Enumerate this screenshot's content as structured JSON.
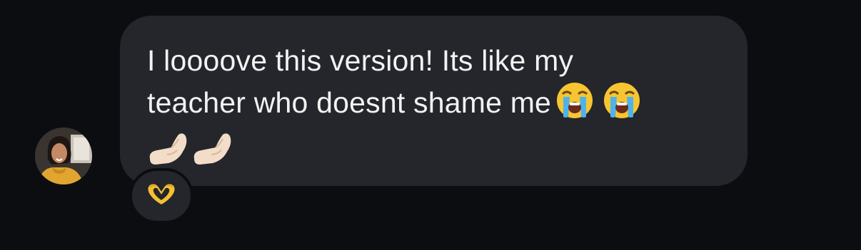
{
  "message": {
    "line1": "I loooove this version! Its like my",
    "line2": "teacher who doesnt shame me",
    "emojis_line2": [
      "loudly-crying-face-emoji",
      "loudly-crying-face-emoji"
    ],
    "emojis_line3": [
      "pinching-hand-emoji",
      "pinching-hand-emoji"
    ]
  },
  "reaction": {
    "emoji": "heart-hands-emoji"
  },
  "colors": {
    "background": "#0b0d11",
    "bubble": "#24262c",
    "text": "#f2f2f2"
  }
}
